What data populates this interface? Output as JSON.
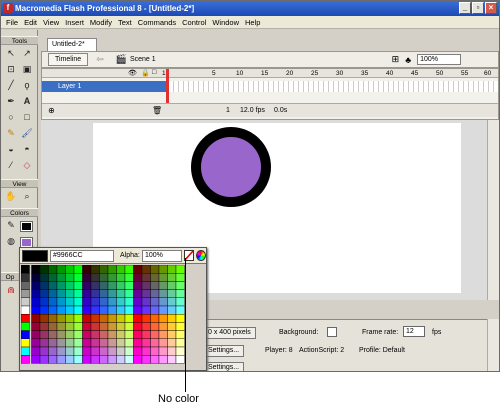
{
  "window": {
    "title": "Macromedia Flash Professional 8 - [Untitled-2*]",
    "icon": "flash-icon",
    "controls": [
      "_",
      "▫",
      "×"
    ]
  },
  "menu": [
    "File",
    "Edit",
    "View",
    "Insert",
    "Modify",
    "Text",
    "Commands",
    "Control",
    "Window",
    "Help"
  ],
  "tools_panel": {
    "title": "Tools",
    "sections": {
      "view": "View",
      "colors": "Colors",
      "options": "Op"
    }
  },
  "document": {
    "tab": "Untitled-2*",
    "timeline_button": "Timeline",
    "scene": "Scene 1",
    "zoom": "100%",
    "layer": "Layer 1",
    "frame_numbers": [
      "1",
      "5",
      "10",
      "15",
      "20",
      "25",
      "30",
      "35",
      "40",
      "45",
      "50",
      "55",
      "60"
    ],
    "status": {
      "frame": "1",
      "fps": "12.0 fps",
      "time": "0.0s"
    }
  },
  "properties": {
    "size_button": "0 x 400 pixels",
    "background_label": "Background:",
    "frame_rate_label": "Frame rate:",
    "frame_rate_value": "12",
    "fps_unit": "fps",
    "settings1": "Settings...",
    "player": "Player: 8",
    "actionscript": "ActionScript: 2",
    "profile": "Profile: Default",
    "settings2": "Settings..."
  },
  "swatch_panel": {
    "hex": "#9966CC",
    "alpha_label": "Alpha:",
    "alpha_value": "100%",
    "selected_color": "#9966CC"
  },
  "caption": "No color"
}
